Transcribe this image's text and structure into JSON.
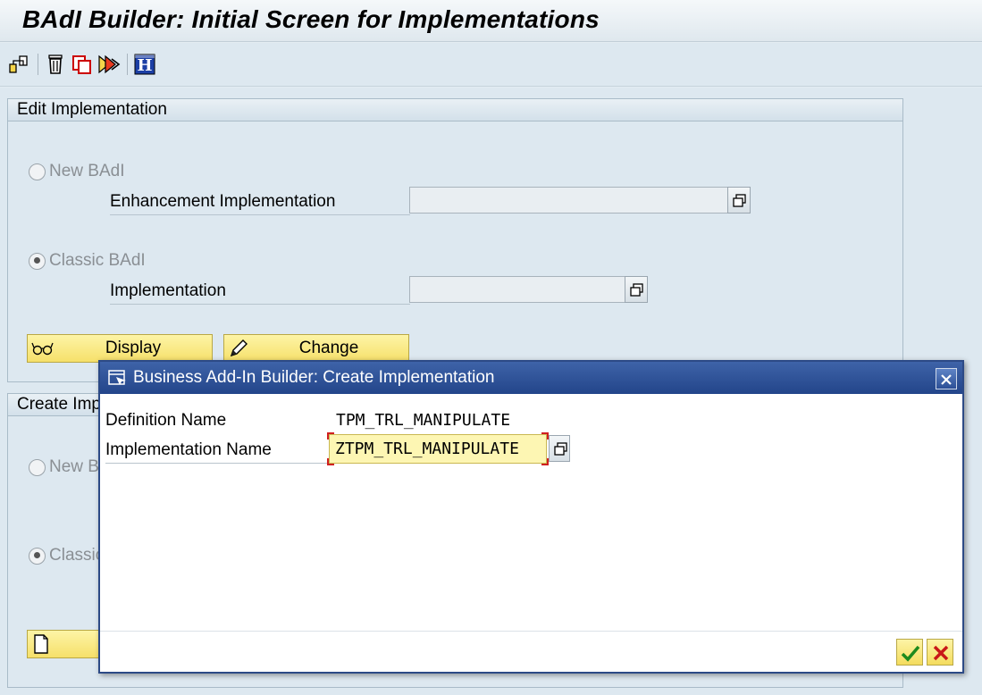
{
  "window": {
    "title": "BAdI Builder: Initial Screen for Implementations"
  },
  "toolbar": {
    "icons": [
      "create-icon",
      "delete-icon",
      "copy-icon",
      "rename-icon",
      "info-icon"
    ]
  },
  "edit_group": {
    "title": "Edit Implementation",
    "new_badi_label": "New BAdI",
    "enh_impl_label": "Enhancement Implementation",
    "enh_impl_value": "",
    "classic_badi_label": "Classic BAdI",
    "impl_label": "Implementation",
    "impl_value": "",
    "display_label": "Display",
    "change_label": "Change"
  },
  "create_group": {
    "title": "Create Imp",
    "new_badi_label": "New B",
    "classic_badi_label": "Classic"
  },
  "dialog": {
    "title": "Business Add-In Builder: Create Implementation",
    "definition_label": "Definition Name",
    "definition_value": "TPM_TRL_MANIPULATE",
    "implementation_label": "Implementation Name",
    "implementation_value": "ZTPM_TRL_MANIPULATE"
  },
  "colors": {
    "dialog_header": "#23458a",
    "button_yellow": "#f6e06a",
    "background": "#dde8f0"
  }
}
